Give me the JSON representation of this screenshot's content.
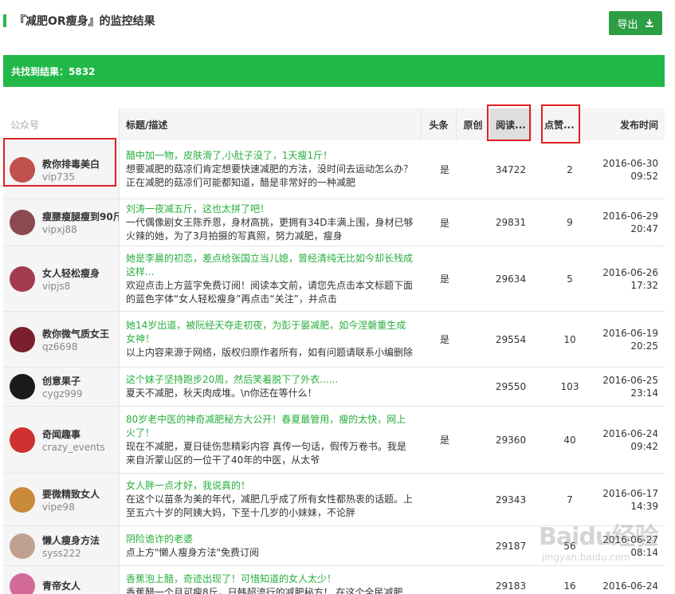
{
  "header": {
    "title": "『减肥OR瘦身』的监控结果",
    "export_label": "导出"
  },
  "result": {
    "text": "共找到结果：5832"
  },
  "columns": {
    "account": "公众号",
    "title": "标题/描述",
    "top": "头条",
    "original": "原创",
    "reads": "阅读...",
    "likes": "点赞...",
    "date": "发布时间"
  },
  "rows": [
    {
      "name": "教你排毒美白",
      "id": "vip735",
      "title": "醋中加一物，皮肤滑了,小肚子没了，1天瘦1斤！",
      "desc": "想要减肥的菇凉们肯定想要快速减肥的方法，没时间去运动怎么办？正在减肥的菇凉们可能都知道，醋是非常好的一种减肥",
      "top": "是",
      "reads": "34722",
      "likes": "2",
      "date": "2016-06-30",
      "time": "09:52",
      "avatar_color": "#c0504d"
    },
    {
      "name": "瘦腰瘦腿瘦到90斤",
      "id": "vipxj88",
      "title": "刘涛一夜减五斤，这也太拼了吧！",
      "desc": "一代偶像剧女王陈乔恩，身材高挑，更拥有34D丰满上围，身材已够火辣的她，为了3月拍摄的写真照，努力减肥，瘦身",
      "top": "是",
      "reads": "29831",
      "likes": "9",
      "date": "2016-06-29",
      "time": "20:47",
      "avatar_color": "#8b4a52"
    },
    {
      "name": "女人轻松瘦身",
      "id": "vipjs8",
      "title": "她是李晨的初恋，差点给张国立当儿媳，曾经清纯无比如今却长残成这样...",
      "desc": "欢迎点击上方蓝字免费订阅！阅读本文前，请您先点击本文标题下面的蓝色字体“女人轻松瘦身”再点击“关注”，并点击",
      "top": "是",
      "reads": "29634",
      "likes": "5",
      "date": "2016-06-26",
      "time": "17:32",
      "avatar_color": "#a33b4e"
    },
    {
      "name": "教你微气质女王",
      "id": "qz6698",
      "title": "她14岁出道，被阮经天夺走初夜，为彭于晏减肥，如今涅磐重生成女神！",
      "desc": "以上内容来源于网络，版权归原作者所有，如有问题请联系小编删除",
      "top": "是",
      "reads": "29554",
      "likes": "10",
      "date": "2016-06-19",
      "time": "20:25",
      "avatar_color": "#7a1f2b"
    },
    {
      "name": "创意果子",
      "id": "cygz999",
      "title": "这个妹子坚持跑步20周，然后笑着脱下了外衣......",
      "desc": "夏天不减肥，秋天肉成堆。\\n你还在等什么！",
      "top": "",
      "reads": "29550",
      "likes": "103",
      "date": "2016-06-25",
      "time": "23:14",
      "avatar_color": "#1a1a1a"
    },
    {
      "name": "奇闻趣事",
      "id": "crazy_events",
      "title": "80岁老中医的神奇减肥秘方大公开！春夏最管用，瘦的太快，网上火了！",
      "desc": "现在不减肥，夏日徒伤悲精彩内容  真传一句话，假传万卷书。我是来自沂蒙山区的一位干了40年的中医，从太爷",
      "top": "是",
      "reads": "29360",
      "likes": "40",
      "date": "2016-06-24",
      "time": "09:42",
      "avatar_color": "#d0302f"
    },
    {
      "name": "要微精致女人",
      "id": "vipe98",
      "title": "女人胖一点才好，我说真的！",
      "desc": "在这个以苗条为美的年代，减肥几乎成了所有女性都热衷的话题。上至五六十岁的阿姨大妈，下至十几岁的小妹妹，不论胖",
      "top": "",
      "reads": "29343",
      "likes": "7",
      "date": "2016-06-17",
      "time": "14:39",
      "avatar_color": "#c98a3a"
    },
    {
      "name": "懒人瘦身方法",
      "id": "syss222",
      "title": "阴险诡诈的老婆",
      "desc": "点上方\"懒人瘦身方法\"免费订阅",
      "top": "",
      "reads": "29187",
      "likes": "56",
      "date": "2016-06-27",
      "time": "08:14",
      "avatar_color": "#c0a090"
    },
    {
      "name": "青帝女人",
      "id": "",
      "title": "香蕉泡上醋，奇迹出现了！可惜知道的女人太少！",
      "desc": "香蕉醋一个月可瘦8斤，日韩超流行的减肥秘方！   在这个全民减肥",
      "top": "",
      "reads": "29183",
      "likes": "16",
      "date": "2016-06-24",
      "time": "",
      "avatar_color": "#d36a9a"
    }
  ],
  "watermark": {
    "logo": "Baidu经验",
    "url": "jingyan.baidu.com"
  },
  "colors": {
    "accent": "#22b848",
    "title_green": "#27ae3d",
    "highlight": "#e02020"
  }
}
